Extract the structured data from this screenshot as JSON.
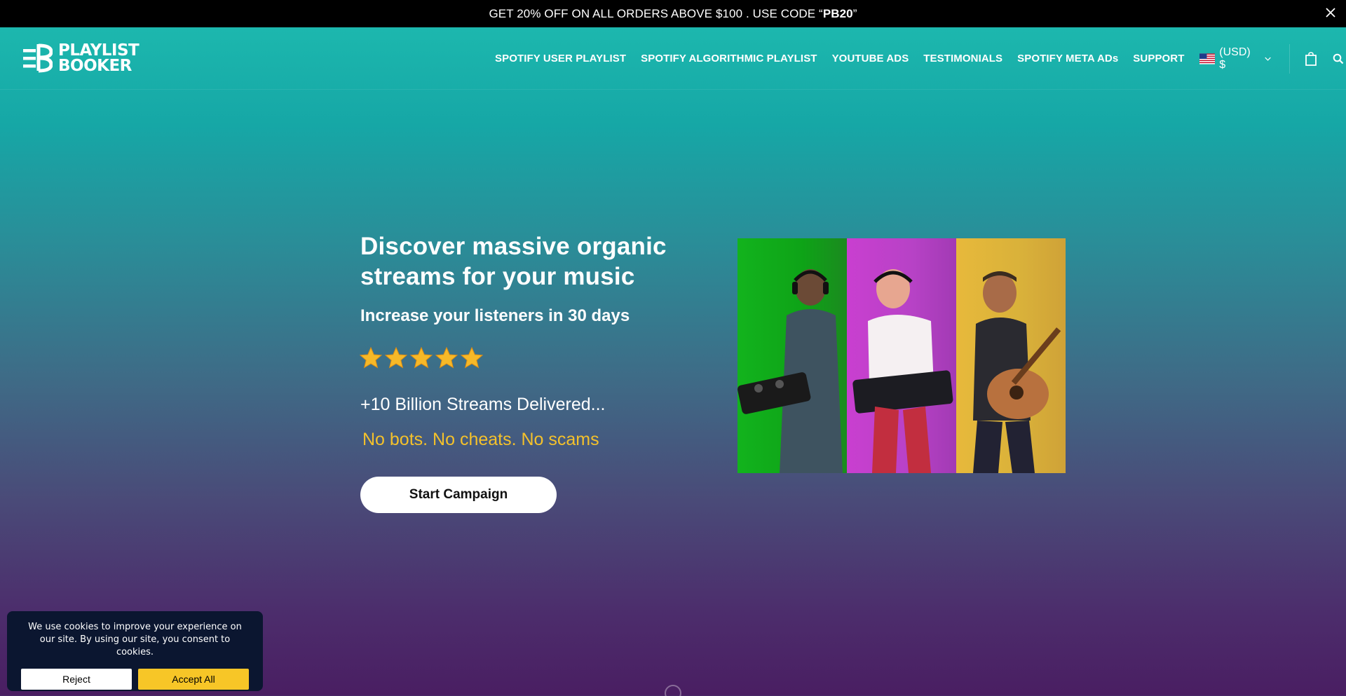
{
  "promo": {
    "text_before": "GET 20% OFF ON ALL ORDERS ABOVE $100 . USE CODE “",
    "code": "PB20",
    "text_after": "”"
  },
  "header": {
    "logo_line1": "PLAYLIST",
    "logo_line2": "BOOKER",
    "nav": [
      "SPOTIFY USER PLAYLIST",
      "SPOTIFY ALGORITHMIC PLAYLIST",
      "YOUTUBE ADS",
      "TESTIMONIALS",
      "SPOTIFY META ADs",
      "SUPPORT"
    ],
    "currency": "(USD) $"
  },
  "hero": {
    "title": "Discover massive organic streams for your music",
    "subtitle": "Increase your listeners in 30 days",
    "rating_stars": 5,
    "streams": "+10 Billion Streams Delivered...",
    "tagline": "No bots. No cheats. No scams",
    "cta": "Start Campaign"
  },
  "cookie": {
    "message": "We use cookies to improve your experience on our site. By using our site, you consent to cookies.",
    "reject": "Reject",
    "accept": "Accept All"
  },
  "colors": {
    "accent_yellow": "#f4c12b",
    "teal": "#1ebcb0",
    "purple": "#4a1e62"
  }
}
